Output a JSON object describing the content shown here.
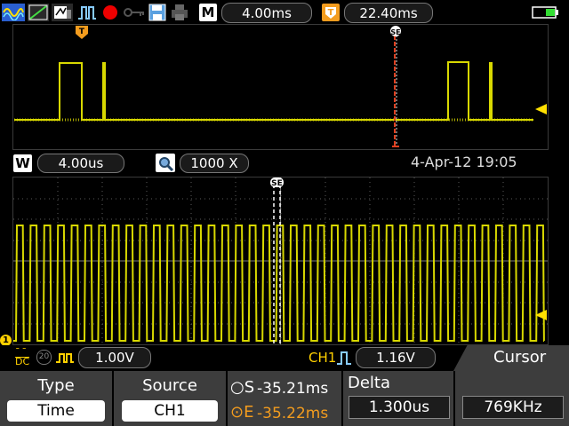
{
  "toolbar": {
    "icons": [
      "display-mode-icon",
      "trend-icon",
      "screen-icon",
      "pulse-icon",
      "record-icon",
      "key-icon",
      "save-icon",
      "print-icon"
    ],
    "timebase_label": "M",
    "timebase_value": "4.00ms",
    "trigger_label": "T",
    "trigger_value": "22.40ms",
    "battery": "battery-icon"
  },
  "overview": {
    "trigger_marker": "T",
    "cursor_marker": "SE"
  },
  "zoom_bar": {
    "window_label": "W",
    "window_value": "4.00us",
    "zoom_factor": "1000 X",
    "datetime": "4-Apr-12 19:05"
  },
  "main_plot": {
    "cursor_marker": "SE",
    "channel_marker": "1"
  },
  "channel_bar": {
    "coupling": "DC",
    "bw_label": "20",
    "volts_div": "1.00V",
    "trig_source": "CH1",
    "trig_level": "1.16V",
    "menu_title": "Cursor"
  },
  "softkeys": {
    "type_title": "Type",
    "type_value": "Time",
    "source_title": "Source",
    "source_value": "CH1",
    "s_label": "S",
    "s_value": "-35.21ms",
    "e_label": "E",
    "e_value": "-35.22ms",
    "delta_title": "Delta",
    "delta_value": "1.300us",
    "freq_value": "769KHz"
  },
  "colors": {
    "trace": "#d8d800",
    "trigger": "#f39c1e",
    "cursor": "#e04020",
    "grid": "#5a5a5a",
    "softkey_bg": "#3d3d3d",
    "battery": "#33dd33"
  }
}
